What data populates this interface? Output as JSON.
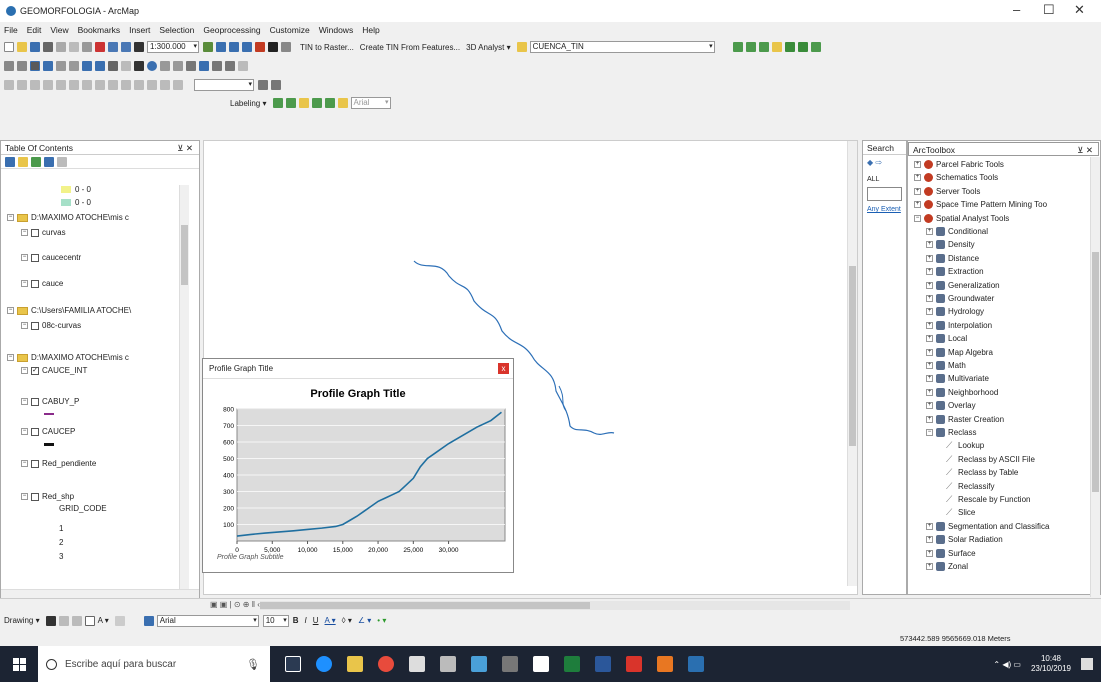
{
  "window": {
    "title": "GEOMORFOLOGIA - ArcMap",
    "min": "–",
    "max": "☐",
    "close": "✕"
  },
  "menu": [
    "File",
    "Edit",
    "View",
    "Bookmarks",
    "Insert",
    "Selection",
    "Geoprocessing",
    "Customize",
    "Windows",
    "Help"
  ],
  "toolbar": {
    "scale": "1:300.000",
    "tin_to_raster": "TIN to Raster...",
    "create_tin": "Create TIN From Features...",
    "analyst3d": "3D Analyst ▾",
    "layer_combo": "CUENCA_TIN",
    "labeling": "Labeling ▾",
    "font_combo": "Arial"
  },
  "toc": {
    "title": "Table Of Contents",
    "items": [
      {
        "label": "0 - 0",
        "kind": "legend"
      },
      {
        "label": "0 - 0",
        "kind": "legend"
      },
      {
        "label": "D:\\MAXIMO ATOCHE\\mis c",
        "kind": "folder"
      },
      {
        "label": "curvas",
        "kind": "layer"
      },
      {
        "label": "caucecentr",
        "kind": "layer"
      },
      {
        "label": "cauce",
        "kind": "layer"
      },
      {
        "label": "C:\\Users\\FAMILIA ATOCHE\\",
        "kind": "folder"
      },
      {
        "label": "08c-curvas",
        "kind": "layer"
      },
      {
        "label": "D:\\MAXIMO ATOCHE\\mis c",
        "kind": "folder"
      },
      {
        "label": "CAUCE_INT",
        "kind": "layer_checked"
      },
      {
        "label": "CABUY_P",
        "kind": "layer"
      },
      {
        "label": "CAUCEP",
        "kind": "layer"
      },
      {
        "label": "Red_pendiente",
        "kind": "layer"
      },
      {
        "label": "Red_shp",
        "kind": "layer"
      },
      {
        "label": "GRID_CODE",
        "kind": "field"
      },
      {
        "label": "1",
        "kind": "value"
      },
      {
        "label": "2",
        "kind": "value"
      },
      {
        "label": "3",
        "kind": "value"
      }
    ]
  },
  "graph": {
    "window_title": "Profile Graph Title",
    "title": "Profile Graph Title",
    "subtitle": "Profile Graph Subtitle",
    "close": "x"
  },
  "chart_data": {
    "type": "line",
    "title": "Profile Graph Title",
    "subtitle": "Profile Graph Subtitle",
    "xlim": [
      0,
      38000
    ],
    "ylim": [
      0,
      800
    ],
    "x_ticks": [
      "0",
      "5,000",
      "10,000",
      "15,000",
      "20,000",
      "25,000",
      "30,000"
    ],
    "y_ticks": [
      "100",
      "200",
      "300",
      "400",
      "500",
      "600",
      "700",
      "800"
    ],
    "x_tick_values": [
      0,
      5000,
      10000,
      15000,
      20000,
      25000,
      30000
    ],
    "y_tick_values": [
      100,
      200,
      300,
      400,
      500,
      600,
      700,
      800
    ],
    "series": [
      {
        "x": [
          0,
          2000,
          4000,
          6000,
          8000,
          10000,
          12000,
          14000,
          15000,
          16000,
          17000,
          18000,
          19000,
          20000,
          21000,
          22000,
          23000,
          24000,
          25000,
          26000,
          27000,
          28000,
          30000,
          32000,
          34000,
          36000,
          37500
        ],
        "y": [
          30,
          40,
          48,
          55,
          62,
          70,
          78,
          88,
          100,
          125,
          150,
          180,
          210,
          240,
          260,
          280,
          300,
          340,
          380,
          450,
          500,
          530,
          590,
          640,
          690,
          730,
          780
        ]
      }
    ],
    "grid": true
  },
  "search": {
    "title": "Search",
    "all": "ALL",
    "link": "Any Extent"
  },
  "toolbox": {
    "title": "ArcToolbox",
    "items": [
      {
        "label": "Parcel Fabric Tools",
        "kind": "box"
      },
      {
        "label": "Schematics Tools",
        "kind": "box"
      },
      {
        "label": "Server Tools",
        "kind": "box"
      },
      {
        "label": "Space Time Pattern Mining Too",
        "kind": "box"
      },
      {
        "label": "Spatial Analyst Tools",
        "kind": "box"
      },
      {
        "label": "Conditional",
        "kind": "set"
      },
      {
        "label": "Density",
        "kind": "set"
      },
      {
        "label": "Distance",
        "kind": "set"
      },
      {
        "label": "Extraction",
        "kind": "set"
      },
      {
        "label": "Generalization",
        "kind": "set"
      },
      {
        "label": "Groundwater",
        "kind": "set"
      },
      {
        "label": "Hydrology",
        "kind": "set"
      },
      {
        "label": "Interpolation",
        "kind": "set"
      },
      {
        "label": "Local",
        "kind": "set"
      },
      {
        "label": "Map Algebra",
        "kind": "set"
      },
      {
        "label": "Math",
        "kind": "set"
      },
      {
        "label": "Multivariate",
        "kind": "set"
      },
      {
        "label": "Neighborhood",
        "kind": "set"
      },
      {
        "label": "Overlay",
        "kind": "set"
      },
      {
        "label": "Raster Creation",
        "kind": "set"
      },
      {
        "label": "Reclass",
        "kind": "set"
      },
      {
        "label": "Lookup",
        "kind": "tool"
      },
      {
        "label": "Reclass by ASCII File",
        "kind": "tool"
      },
      {
        "label": "Reclass by Table",
        "kind": "tool"
      },
      {
        "label": "Reclassify",
        "kind": "tool"
      },
      {
        "label": "Rescale by Function",
        "kind": "tool"
      },
      {
        "label": "Slice",
        "kind": "tool"
      },
      {
        "label": "Segmentation and Classifica",
        "kind": "set"
      },
      {
        "label": "Solar Radiation",
        "kind": "set"
      },
      {
        "label": "Surface",
        "kind": "set"
      },
      {
        "label": "Zonal",
        "kind": "set"
      }
    ]
  },
  "drawing": {
    "label": "Drawing ▾",
    "font": "Arial",
    "size": "10"
  },
  "status": {
    "coords": "573442.589 9565669.018 Meters"
  },
  "taskbar": {
    "search": "Escribe aquí para buscar",
    "time": "10:48",
    "date": "23/10/2019"
  },
  "colors": {
    "river": "#2c6fb7",
    "profile": "#1f6fa0",
    "taskbar": "#1c2433",
    "plot_bg": "#dcdcdc"
  }
}
